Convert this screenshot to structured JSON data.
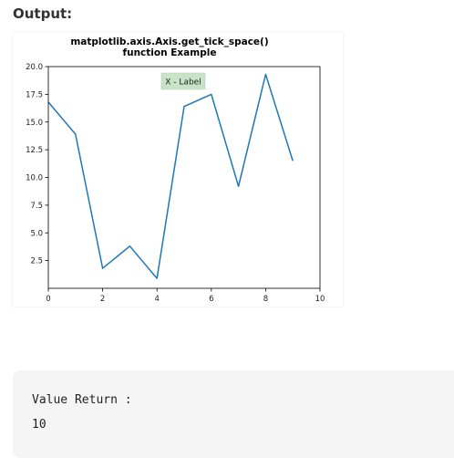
{
  "page": {
    "heading": "Output:"
  },
  "chart_data": {
    "type": "line",
    "title_line1": "matplotlib.axis.Axis.get_tick_space()",
    "title_line2": "function Example",
    "annotation": "X - Label",
    "xlim": [
      0,
      10
    ],
    "ylim": [
      0,
      20
    ],
    "xticks": [
      0,
      2,
      4,
      6,
      8,
      10
    ],
    "yticks": [
      2.5,
      5.0,
      7.5,
      10.0,
      12.5,
      15.0,
      17.5,
      20.0
    ],
    "x": [
      0,
      1,
      2,
      3,
      4,
      5,
      6,
      7,
      8,
      9
    ],
    "y": [
      16.8,
      13.9,
      1.8,
      3.8,
      0.9,
      16.4,
      17.5,
      9.2,
      19.3,
      11.5
    ],
    "line_color": "#1f77b4",
    "annotation_bg": "#c8e3c8",
    "grid": false
  },
  "output": {
    "line1": "Value Return :",
    "line2": "10"
  }
}
